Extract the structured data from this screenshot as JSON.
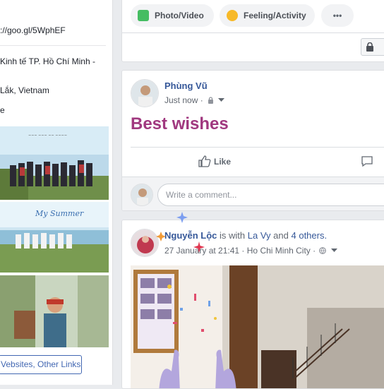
{
  "left": {
    "website": "://goo.gl/5WphEF",
    "school": "Kinh tế TP. Hồ Chí Minh -",
    "location": "Lắk, Vietnam",
    "more": "e",
    "links_button": "Vebsites, Other Links",
    "photo2_caption": "My Summer"
  },
  "composer": {
    "photo_video": "Photo/Video",
    "feeling": "Feeling/Activity",
    "more": "•••"
  },
  "post1": {
    "author": "Phùng Vũ",
    "time": "Just now ·",
    "text": "Best wishes",
    "like": "Like",
    "comment_placeholder": "Write a comment..."
  },
  "post2": {
    "author": "Nguyễn Lộc",
    "is_with": "is with",
    "tagged": "La Vy",
    "and": "and",
    "others": "4 others.",
    "date": "27 January at 21:41 ·",
    "place": "Ho Chi Minh City ·"
  },
  "colors": {
    "link": "#365899",
    "best_wishes": "#a0387f",
    "page_bg": "#e9ebee"
  }
}
